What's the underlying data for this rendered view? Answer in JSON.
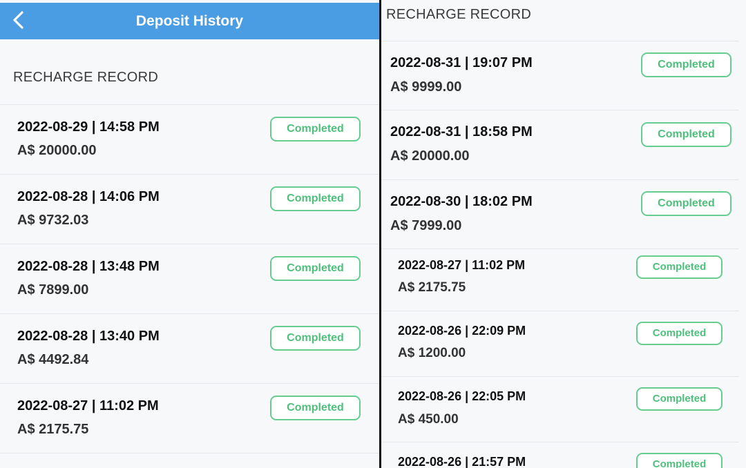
{
  "header": {
    "title": "Deposit History",
    "back_icon": "chevron-left-icon"
  },
  "left": {
    "section_title": "RECHARGE RECORD",
    "records": [
      {
        "date": "2022-08-29 | 14:58 PM",
        "amount": "A$ 20000.00",
        "status": "Completed"
      },
      {
        "date": "2022-08-28 | 14:06 PM",
        "amount": "A$ 9732.03",
        "status": "Completed"
      },
      {
        "date": "2022-08-28 | 13:48 PM",
        "amount": "A$ 7899.00",
        "status": "Completed"
      },
      {
        "date": "2022-08-28 | 13:40 PM",
        "amount": "A$ 4492.84",
        "status": "Completed"
      },
      {
        "date": "2022-08-27 | 11:02 PM",
        "amount": "A$ 2175.75",
        "status": "Completed"
      }
    ]
  },
  "right": {
    "section_title": "RECHARGE RECORD",
    "records": [
      {
        "date": "2022-08-31 | 19:07 PM",
        "amount": "A$ 9999.00",
        "status": "Completed"
      },
      {
        "date": "2022-08-31 | 18:58 PM",
        "amount": "A$ 20000.00",
        "status": "Completed"
      },
      {
        "date": "2022-08-30 | 18:02 PM",
        "amount": "A$ 7999.00",
        "status": "Completed"
      },
      {
        "date": "2022-08-27 | 11:02 PM",
        "amount": "A$ 2175.75",
        "status": "Completed"
      },
      {
        "date": "2022-08-26 | 22:09 PM",
        "amount": "A$ 1200.00",
        "status": "Completed"
      },
      {
        "date": "2022-08-26 | 22:05 PM",
        "amount": "A$ 450.00",
        "status": "Completed"
      },
      {
        "date": "2022-08-26 | 21:57 PM",
        "amount": "",
        "status": "Completed"
      }
    ]
  },
  "colors": {
    "header_bg": "#4a9de2",
    "badge_green": "#66cc8f",
    "background": "#f7f8fa",
    "divider": "#111111"
  }
}
